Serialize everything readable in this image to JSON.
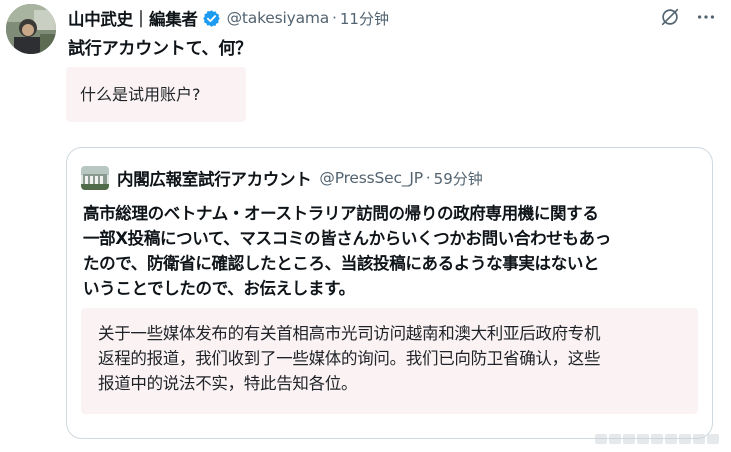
{
  "tweet": {
    "author_name": "山中武史｜編集者",
    "handle": "@takesiyama",
    "separator": "·",
    "time": "11分钟",
    "text": "試行アカウントて、何？",
    "translation": "什么是试用账户?"
  },
  "quoted_tweet": {
    "author_name": "内閣広報室試行アカウント",
    "handle": "@PressSec_JP",
    "separator": "·",
    "time": "59分钟",
    "text_lines": [
      "高市総理のベトナム・オーストラリア訪問の帰りの政府専用機に関する",
      "一部X投稿について、マスコミの皆さんからいくつかお問い合わせもあっ",
      "たので、防衛省に確認したところ、当該投稿にあるような事実はないと",
      "いうことでしたので、お伝えします。"
    ],
    "translation_lines": [
      "关于一些媒体发布的有关首相高市光司访问越南和澳大利亚后政府专机",
      "返程的报道，我们收到了一些媒体的询问。我们已向防卫省确认，这些",
      "报道中的说法不实，特此告知各位。"
    ]
  },
  "icons": {
    "verified": "verified-badge-icon",
    "tools": [
      "translate-slash-icon",
      "more-icon"
    ]
  },
  "colors": {
    "verified_blue": "#1d9bf0",
    "secondary_text": "#536471",
    "translation_bg": "#fbf3f3",
    "border": "#cfd9de"
  }
}
